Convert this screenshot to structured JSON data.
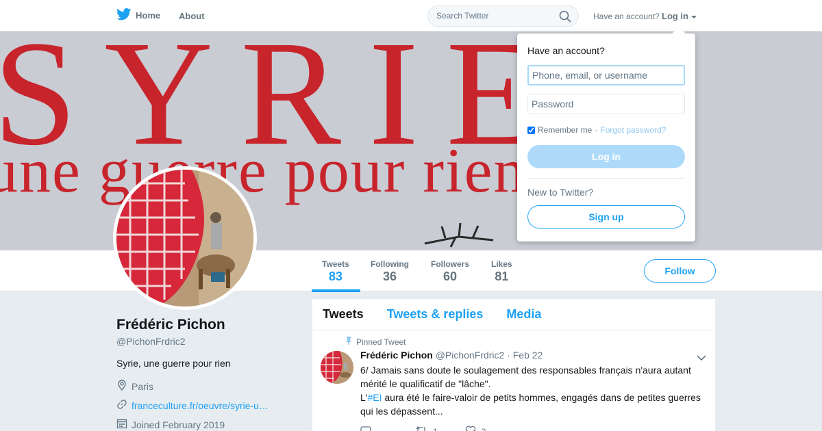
{
  "nav": {
    "home_label": "Home",
    "about_label": "About",
    "search_placeholder": "Search Twitter",
    "have_account_label": "Have an account?",
    "login_label": "Log in",
    "icons": {
      "logo": "twitter-bird-icon",
      "search": "search-icon",
      "caret": "caret-down-icon"
    }
  },
  "banner": {
    "text_line1": "SYRIE",
    "text_line2": "une guerre pour rien"
  },
  "profile": {
    "name": "Frédéric Pichon",
    "handle": "@PichonFrdric2",
    "bio": "Syrie, une guerre pour rien",
    "location": "Paris",
    "url": "franceculture.fr/oeuvre/syrie-u…",
    "joined": "Joined February 2019",
    "follow_label": "Follow"
  },
  "stats": [
    {
      "label": "Tweets",
      "value": "83",
      "active": true
    },
    {
      "label": "Following",
      "value": "36"
    },
    {
      "label": "Followers",
      "value": "60"
    },
    {
      "label": "Likes",
      "value": "81"
    }
  ],
  "timeline": {
    "tabs": [
      "Tweets",
      "Tweets & replies",
      "Media"
    ],
    "pinned_label": "Pinned Tweet",
    "tweet": {
      "name": "Frédéric Pichon",
      "handle": "@PichonFrdric2",
      "sep": "·",
      "date": "Feb 22",
      "text_line1": "6/ Jamais sans doute le soulagement des responsables français n'aura autant mérité le qualificatif de \"lâche\".",
      "text_prefix": "L'",
      "hashtag": "#EI",
      "text_line2": " aura été le faire-valoir de petits hommes, engagés dans de petites guerres qui les dépassent...",
      "retweets": "1",
      "likes": "2"
    }
  },
  "login_dropdown": {
    "title": "Have an account?",
    "username_placeholder": "Phone, email, or username",
    "password_placeholder": "Password",
    "remember_label": "Remember me",
    "sep": "·",
    "forgot_label": "Forgot password?",
    "login_button": "Log in",
    "new_label": "New to Twitter?",
    "signup_button": "Sign up"
  },
  "colors": {
    "accent": "#1da1f2",
    "banner_red": "#c8242c",
    "background": "#e6ecf0"
  }
}
